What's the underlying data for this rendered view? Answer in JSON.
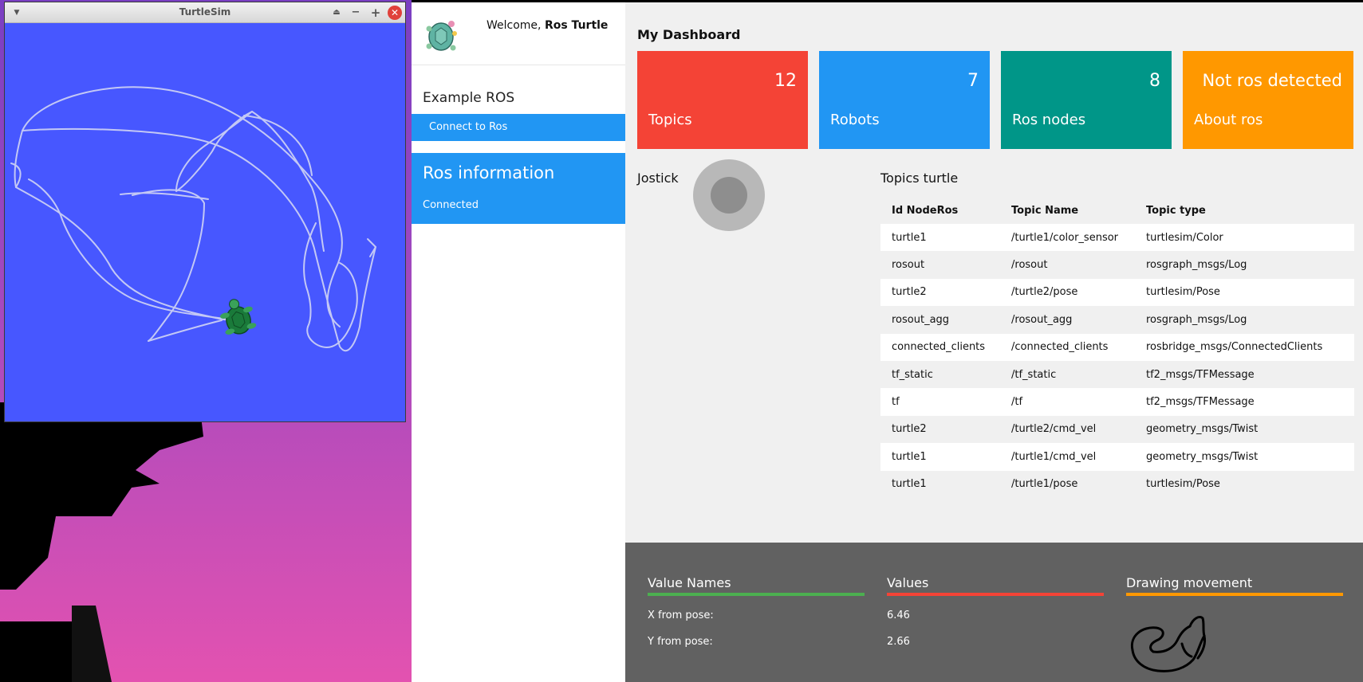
{
  "turtlesim": {
    "title": "TurtleSim",
    "menu_icon": "chevron-down-icon",
    "shade_icon": "shade-icon",
    "min_icon": "minimize-icon",
    "max_icon": "maximize-icon",
    "close_icon": "close-icon",
    "background_color": "#4757ff",
    "trail_color": "#c3c8f5"
  },
  "sidebar": {
    "welcome_prefix": "Welcome, ",
    "user_name": "Ros Turtle",
    "section_title": "Example ROS",
    "connect_label": "Connect to Ros",
    "info_title": "Ros information",
    "info_status": "Connected"
  },
  "dashboard": {
    "title": "My Dashboard",
    "cards": [
      {
        "value": "12",
        "label": "Topics",
        "color": "#f44336"
      },
      {
        "value": "7",
        "label": "Robots",
        "color": "#2196f3"
      },
      {
        "value": "8",
        "label": "Ros nodes",
        "color": "#009688"
      },
      {
        "value": "Not ros detected",
        "label": "About ros",
        "color": "#ff9800"
      }
    ],
    "joystick_label": "Jostick",
    "topics_title": "Topics turtle",
    "table": {
      "headers": [
        "Id NodeRos",
        "Topic Name",
        "Topic type"
      ],
      "rows": [
        [
          "turtle1",
          "/turtle1/color_sensor",
          "turtlesim/Color"
        ],
        [
          "rosout",
          "/rosout",
          "rosgraph_msgs/Log"
        ],
        [
          "turtle2",
          "/turtle2/pose",
          "turtlesim/Pose"
        ],
        [
          "rosout_agg",
          "/rosout_agg",
          "rosgraph_msgs/Log"
        ],
        [
          "connected_clients",
          "/connected_clients",
          "rosbridge_msgs/ConnectedClients"
        ],
        [
          "tf_static",
          "/tf_static",
          "tf2_msgs/TFMessage"
        ],
        [
          "tf",
          "/tf",
          "tf2_msgs/TFMessage"
        ],
        [
          "turtle2",
          "/turtle2/cmd_vel",
          "geometry_msgs/Twist"
        ],
        [
          "turtle1",
          "/turtle1/cmd_vel",
          "geometry_msgs/Twist"
        ],
        [
          "turtle1",
          "/turtle1/pose",
          "turtlesim/Pose"
        ]
      ]
    }
  },
  "footer": {
    "names_title": "Value Names",
    "values_title": "Values",
    "drawing_title": "Drawing movement",
    "x_name": "X from pose:",
    "y_name": "Y from pose:",
    "x_value": "6.46",
    "y_value": "2.66"
  }
}
